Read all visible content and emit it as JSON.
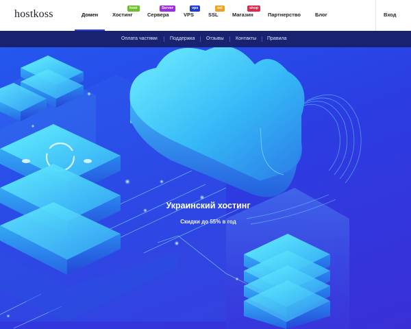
{
  "header": {
    "logo": "hostkoss",
    "login": "Вход"
  },
  "nav": {
    "items": [
      {
        "label": "Домен"
      },
      {
        "label": "Хостинг",
        "badge": "host",
        "badge_color": "#6cbf2a"
      },
      {
        "label": "Сервера",
        "badge": "Server",
        "badge_color": "#9b2ee0"
      },
      {
        "label": "VPS",
        "badge": "vps",
        "badge_color": "#1a3bd6"
      },
      {
        "label": "SSL",
        "badge": "ssl",
        "badge_color": "#f0a020"
      },
      {
        "label": "Магазин",
        "badge": "shop",
        "badge_color": "#e0284a"
      },
      {
        "label": "Партнерство"
      },
      {
        "label": "Блог"
      }
    ]
  },
  "subnav": {
    "items": [
      "Оплата частями",
      "Поддержка",
      "Отзывы",
      "Контакты",
      "Правила"
    ]
  },
  "hero": {
    "title": "Украинский хостинг",
    "subtitle": "Скидки до 55% в год"
  },
  "colors": {
    "brand": "#2b3ce0",
    "subnav_bg": "#182270",
    "hero_bg": "#2b3de2"
  }
}
